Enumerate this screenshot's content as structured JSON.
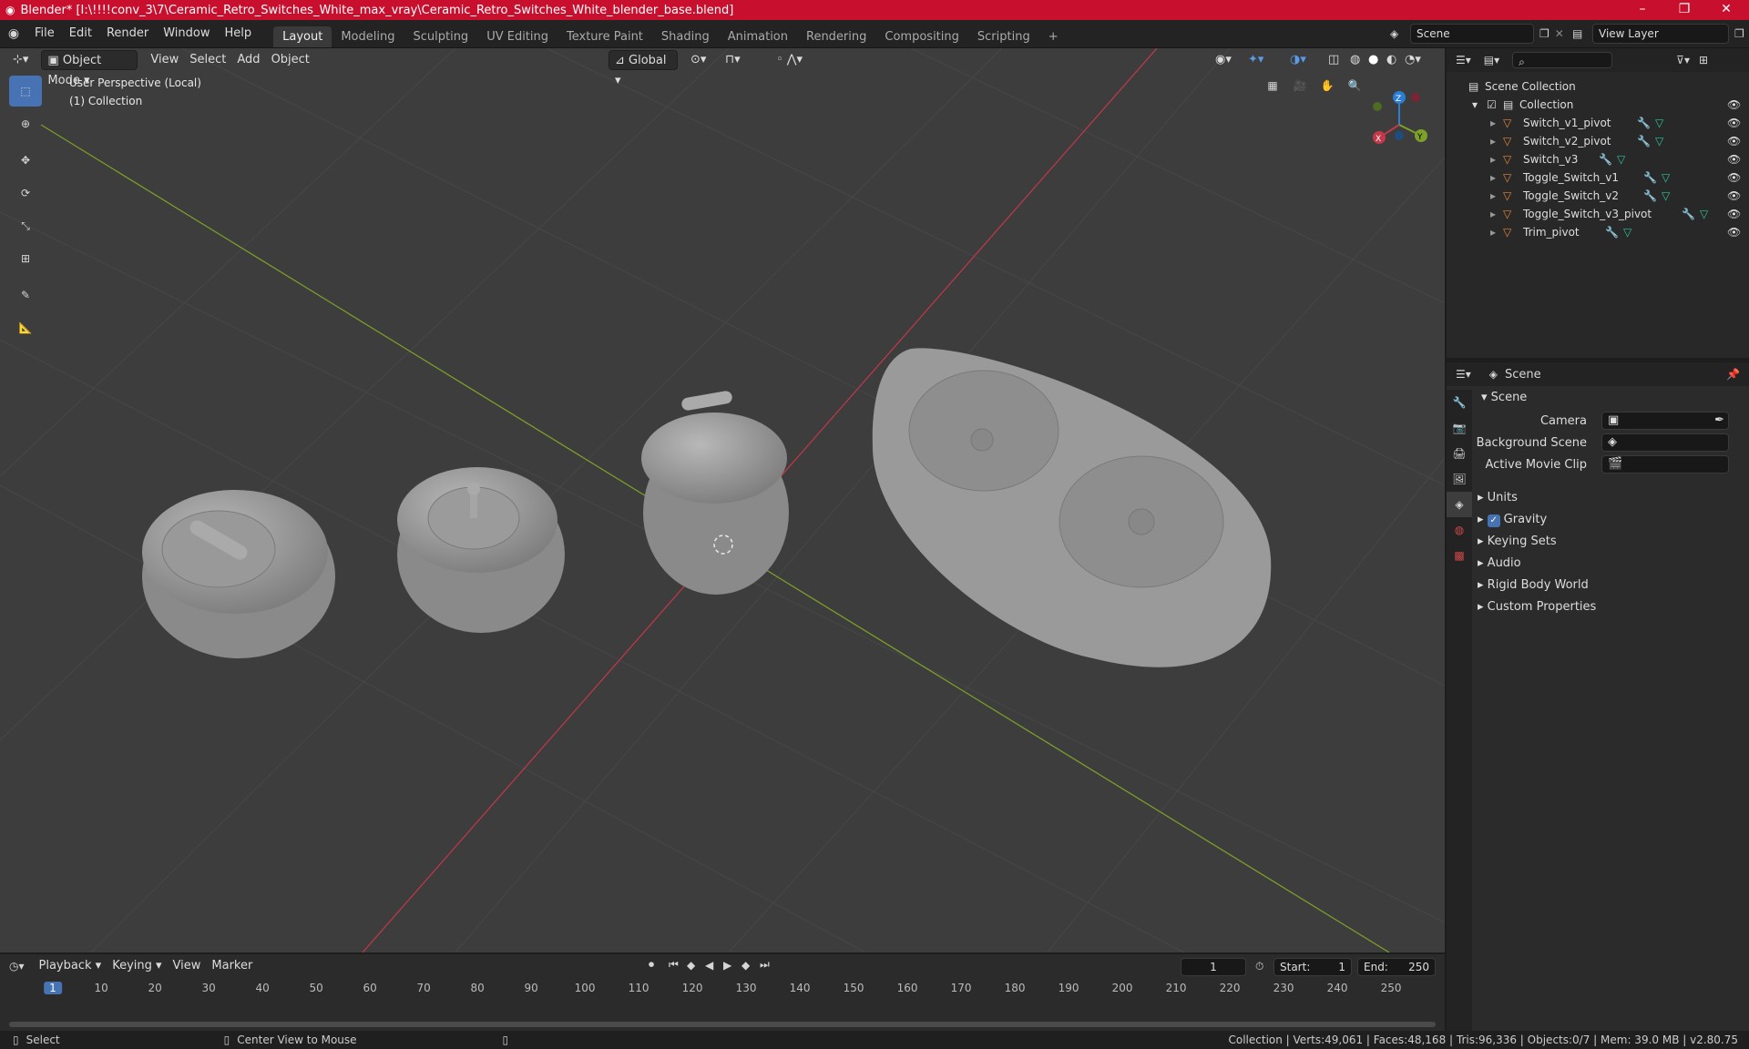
{
  "titlebar": {
    "title": "Blender* [I:\\!!!!conv_3\\7\\Ceramic_Retro_Switches_White_max_vray\\Ceramic_Retro_Switches_White_blender_base.blend]"
  },
  "menu": [
    "File",
    "Edit",
    "Render",
    "Window",
    "Help"
  ],
  "workspaces": [
    "Layout",
    "Modeling",
    "Sculpting",
    "UV Editing",
    "Texture Paint",
    "Shading",
    "Animation",
    "Rendering",
    "Compositing",
    "Scripting"
  ],
  "scene_field": "Scene",
  "view_layer_field": "View Layer",
  "viewport": {
    "mode": "Object Mode",
    "menus": [
      "View",
      "Select",
      "Add",
      "Object"
    ],
    "transform_orientation": "Global",
    "perspective_label": "User Perspective (Local)",
    "collection_label": "(1) Collection",
    "axes": {
      "x": "X",
      "y": "Y",
      "z": "Z"
    }
  },
  "outliner": {
    "root": "Scene Collection",
    "collection": "Collection",
    "items": [
      "Switch_v1_pivot",
      "Switch_v2_pivot",
      "Switch_v3",
      "Toggle_Switch_v1",
      "Toggle_Switch_v2",
      "Toggle_Switch_v3_pivot",
      "Trim_pivot"
    ]
  },
  "properties": {
    "header": "Scene",
    "panel": "Scene",
    "camera_label": "Camera",
    "background_scene_label": "Background Scene",
    "active_clip_label": "Active Movie Clip",
    "sections": [
      "Units",
      "Gravity",
      "Keying Sets",
      "Audio",
      "Rigid Body World",
      "Custom Properties"
    ]
  },
  "timeline": {
    "menus": [
      "Playback",
      "Keying",
      "View",
      "Marker"
    ],
    "current_frame": "1",
    "start_label": "Start:",
    "start": "1",
    "end_label": "End:",
    "end": "250",
    "ticks": [
      "1",
      "10",
      "20",
      "30",
      "40",
      "50",
      "60",
      "70",
      "80",
      "90",
      "100",
      "110",
      "120",
      "130",
      "140",
      "150",
      "160",
      "170",
      "180",
      "190",
      "200",
      "210",
      "220",
      "230",
      "240",
      "250"
    ]
  },
  "status": {
    "select": "Select",
    "center": "Center View to Mouse",
    "stats": "Collection | Verts:49,061 | Faces:48,168 | Tris:96,336 | Objects:0/7 | Mem: 39.0 MB | v2.80.75"
  },
  "colors": {
    "accent": "#4772b3",
    "title_bar": "#c8102e",
    "x_axis": "#c4384a",
    "y_axis": "#7da028",
    "z_axis": "#2a7fd4"
  }
}
